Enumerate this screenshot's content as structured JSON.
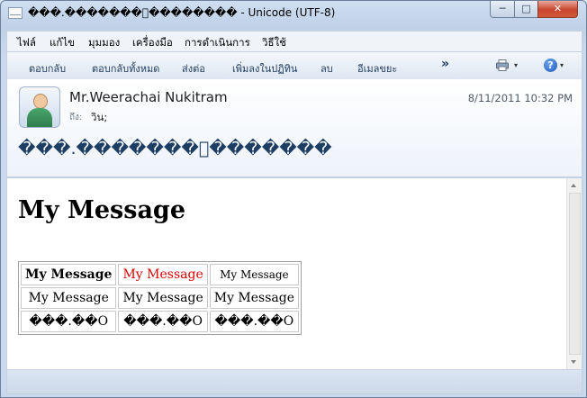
{
  "window": {
    "title": "���.�������ั�������� - Unicode (UTF-8)",
    "min_glyph": "─",
    "max_glyph": "□",
    "close_glyph": "✕"
  },
  "menu": [
    "ไฟล์",
    "แก้ไข",
    "มุมมอง",
    "เครื่องมือ",
    "การดำเนินการ",
    "วิธีใช้"
  ],
  "toolbar": {
    "items": [
      "ตอบกลับ",
      "ตอบกลับทั้งหมด",
      "ส่งต่อ",
      "เพิ่มลงในปฏิทิน",
      "ลบ",
      "อีเมลขยะ"
    ],
    "more": "»",
    "help_glyph": "?",
    "dropdown_glyph": "▾"
  },
  "header": {
    "sender": "Mr.Weerachai Nukitram",
    "date": "8/11/2011 10:32 PM",
    "to_label": "ถึง:",
    "to_value": "วิน;",
    "subject": "���.�������ั�������"
  },
  "message": {
    "heading": "My Message",
    "rows": [
      [
        "My Message",
        "My Message",
        "My Message"
      ],
      [
        "My Message",
        "My Message",
        "My Message"
      ],
      [
        "���.��O",
        "���.��O",
        "���.��O"
      ]
    ]
  },
  "colors": {
    "red_text": "#d80000",
    "subject_text": "#1e3d63"
  }
}
